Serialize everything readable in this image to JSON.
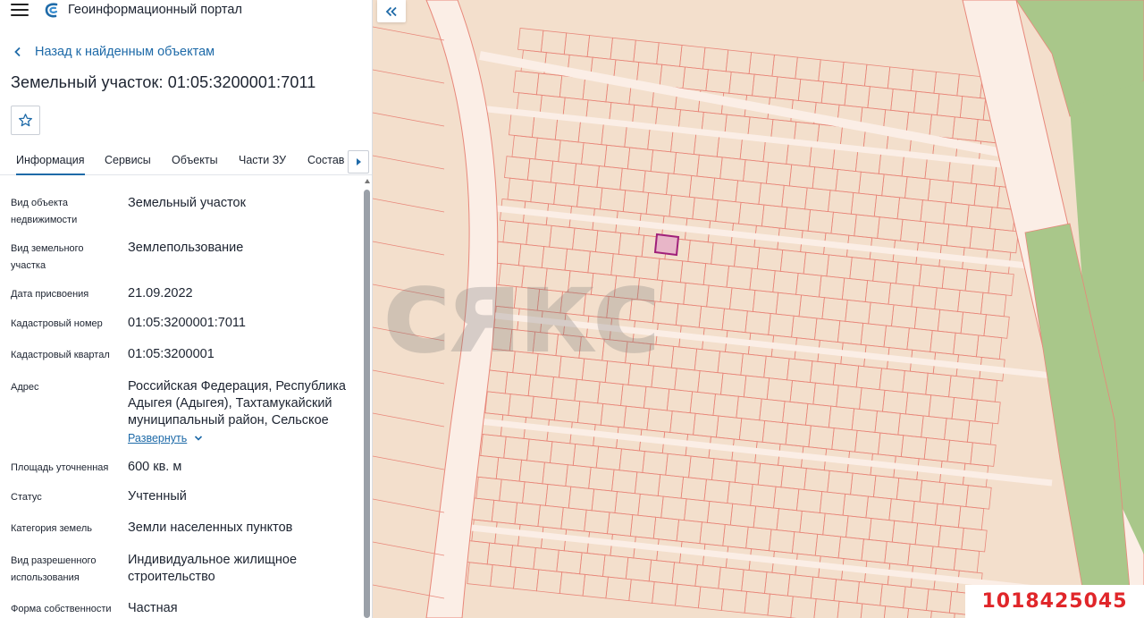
{
  "header": {
    "app_title": "Геоинформационный портал"
  },
  "nav": {
    "back_label": "Назад к найденным объектам"
  },
  "object": {
    "title": "Земельный участок: 01:05:3200001:7011"
  },
  "tabs": [
    {
      "label": "Информация",
      "active": true
    },
    {
      "label": "Сервисы",
      "active": false
    },
    {
      "label": "Объекты",
      "active": false
    },
    {
      "label": "Части ЗУ",
      "active": false
    },
    {
      "label": "Состав",
      "active": false
    }
  ],
  "details": [
    {
      "label": "Вид объекта недвижимости",
      "value": "Земельный участок"
    },
    {
      "label": "Вид земельного участка",
      "value": "Землепользование"
    },
    {
      "label": "Дата присвоения",
      "value": "21.09.2022"
    },
    {
      "label": "Кадастровый номер",
      "value": "01:05:3200001:7011"
    },
    {
      "label": "Кадастровый квартал",
      "value": "01:05:3200001"
    },
    {
      "label": "Адрес",
      "value": "Российская Федерация, Республика Адыгея (Адыгея), Тахтамукайский муниципальный район, Сельское"
    },
    {
      "label": "Площадь уточненная",
      "value": "600 кв. м"
    },
    {
      "label": "Статус",
      "value": "Учтенный"
    },
    {
      "label": "Категория земель",
      "value": "Земли населенных пунктов"
    },
    {
      "label": "Вид разрешенного использования",
      "value": "Индивидуальное жилищное строительство"
    },
    {
      "label": "Форма собственности",
      "value": "Частная"
    }
  ],
  "address_expand_label": "Развернуть",
  "map": {
    "watermark": "сякс",
    "listing_id": "1018425045",
    "colors": {
      "parcel_fill": "#f3dfcc",
      "parcel_line": "#e8877a",
      "road": "#fbeee6",
      "green_area": "#a9c78a",
      "selected_fill": "#e8b6c8",
      "selected_line": "#a0207a"
    }
  },
  "icons": {
    "menu": "hamburger-menu-icon",
    "logo": "portal-logo-icon",
    "back": "chevron-left-icon",
    "favorite": "star-outline-icon",
    "tabs_next": "triangle-right-icon",
    "collapse": "double-chevron-left-icon",
    "expand": "chevron-down-icon"
  }
}
